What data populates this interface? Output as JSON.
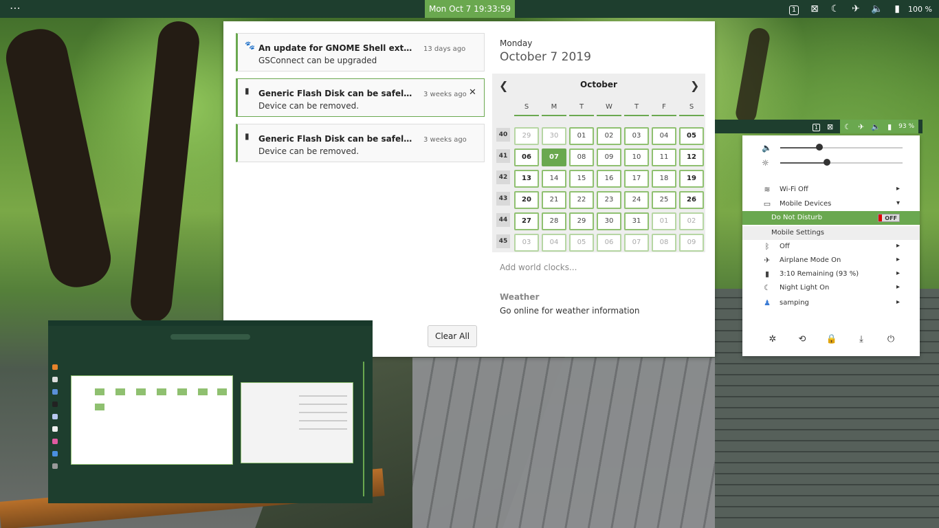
{
  "topbar": {
    "activities_glyph": "⋯",
    "clock": "Mon Oct 7  19:33:59",
    "workspace_badge": "1",
    "battery_percent": "100 %"
  },
  "notifications": [
    {
      "icon": "gnome-foot-icon",
      "title": "An update for GNOME Shell extensions a...",
      "body": "GSConnect can be upgraded",
      "time": "13 days ago",
      "selected": false
    },
    {
      "icon": "usb-drive-icon",
      "title": "Generic Flash Disk can be safely unplug...",
      "body": "Device can be removed.",
      "time": "3 weeks ago",
      "selected": true
    },
    {
      "icon": "usb-drive-icon",
      "title": "Generic Flash Disk can be safely unplug...",
      "body": "Device can be removed.",
      "time": "3 weeks ago",
      "selected": false
    }
  ],
  "clear_all_label": "Clear All",
  "calendar": {
    "weekday": "Monday",
    "date": "October  7 2019",
    "month": "October",
    "weekday_headers": [
      "S",
      "M",
      "T",
      "W",
      "T",
      "F",
      "S"
    ],
    "weeks": [
      {
        "num": "40",
        "days": [
          "29",
          "30",
          "01",
          "02",
          "03",
          "04",
          "05"
        ]
      },
      {
        "num": "41",
        "days": [
          "06",
          "07",
          "08",
          "09",
          "10",
          "11",
          "12"
        ]
      },
      {
        "num": "42",
        "days": [
          "13",
          "14",
          "15",
          "16",
          "17",
          "18",
          "19"
        ]
      },
      {
        "num": "43",
        "days": [
          "20",
          "21",
          "22",
          "23",
          "24",
          "25",
          "26"
        ]
      },
      {
        "num": "44",
        "days": [
          "27",
          "28",
          "29",
          "30",
          "31",
          "01",
          "02"
        ]
      },
      {
        "num": "45",
        "days": [
          "03",
          "04",
          "05",
          "06",
          "07",
          "08",
          "09"
        ]
      }
    ],
    "today": "07"
  },
  "world_clocks_label": "Add world clocks...",
  "weather": {
    "title": "Weather",
    "text": "Go online for weather information"
  },
  "minibar": {
    "workspace_badge": "1",
    "battery_percent": "93 %"
  },
  "system_menu": {
    "volume_level": 0.32,
    "brightness_level": 0.38,
    "items": [
      {
        "icon": "wifi-icon",
        "label": "Wi-Fi Off",
        "arrow": "▸"
      },
      {
        "icon": "mobile-devices-icon",
        "label": "Mobile Devices",
        "arrow": "▾"
      },
      {
        "icon": "",
        "label": "Do Not Disturb",
        "toggle": "OFF"
      },
      {
        "icon": "",
        "label": "Mobile Settings"
      },
      {
        "icon": "bluetooth-icon",
        "label": "Off",
        "arrow": "▸"
      },
      {
        "icon": "airplane-icon",
        "label": "Airplane Mode On",
        "arrow": "▸"
      },
      {
        "icon": "battery-icon",
        "label": "3:10 Remaining (93 %)",
        "arrow": "▸"
      },
      {
        "icon": "night-light-icon",
        "label": "Night Light On",
        "arrow": "▸"
      },
      {
        "icon": "user-icon",
        "label": "samping",
        "arrow": "▸"
      }
    ]
  },
  "colors": {
    "accent": "#6aa84f",
    "panel": "#1e3e2e"
  }
}
